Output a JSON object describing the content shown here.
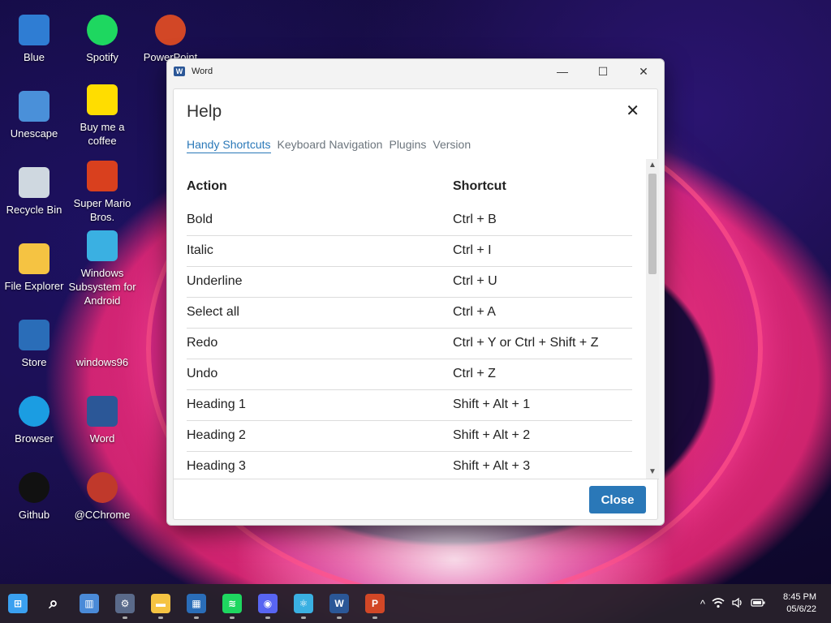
{
  "desktop": {
    "icons": [
      {
        "label": "Blue",
        "icon": "blue-person-icon",
        "color": "#2f7dd3"
      },
      {
        "label": "Spotify",
        "icon": "spotify-icon",
        "color": "#1ed760"
      },
      {
        "label": "PowerPoint",
        "icon": "powerpoint-icon",
        "color": "#d24726"
      },
      {
        "label": "Unescape",
        "icon": "unescape-icon",
        "color": "#4a90d9"
      },
      {
        "label": "Buy me a coffee",
        "icon": "coffee-icon",
        "color": "#ffdd00"
      },
      {
        "label": "Recycle Bin",
        "icon": "recycle-bin-icon",
        "color": "#cfd8e0"
      },
      {
        "label": "Super Mario Bros.",
        "icon": "mario-icon",
        "color": "#d9401e"
      },
      {
        "label": "File Explorer",
        "icon": "folder-icon",
        "color": "#f5c342"
      },
      {
        "label": "Windows Subsystem for Android",
        "icon": "android-subsystem-icon",
        "color": "#3ab0e2"
      },
      {
        "label": "Store",
        "icon": "store-icon",
        "color": "#2a6db8"
      },
      {
        "label": "windows96",
        "icon": "windows96-icon",
        "color": "#000000"
      },
      {
        "label": "Browser",
        "icon": "edge-icon",
        "color": "#1b9de2"
      },
      {
        "label": "Word",
        "icon": "word-icon",
        "color": "#2b5797"
      },
      {
        "label": "Github",
        "icon": "github-icon",
        "color": "#111111"
      },
      {
        "label": "@CChrome",
        "icon": "cchrome-icon",
        "color": "#c0392b"
      }
    ]
  },
  "window": {
    "title": "Word",
    "controls": {
      "minimize": "—",
      "maximize": "☐",
      "close": "✕"
    }
  },
  "dialog": {
    "title": "Help",
    "close_glyph": "✕",
    "tabs": [
      {
        "label": "Handy Shortcuts",
        "active": true
      },
      {
        "label": "Keyboard Navigation",
        "active": false
      },
      {
        "label": "Plugins",
        "active": false
      },
      {
        "label": "Version",
        "active": false
      }
    ],
    "table": {
      "headers": {
        "action": "Action",
        "shortcut": "Shortcut"
      },
      "rows": [
        {
          "action": "Bold",
          "shortcut": "Ctrl + B"
        },
        {
          "action": "Italic",
          "shortcut": "Ctrl + I"
        },
        {
          "action": "Underline",
          "shortcut": "Ctrl + U"
        },
        {
          "action": "Select all",
          "shortcut": "Ctrl + A"
        },
        {
          "action": "Redo",
          "shortcut": "Ctrl + Y or Ctrl + Shift + Z"
        },
        {
          "action": "Undo",
          "shortcut": "Ctrl + Z"
        },
        {
          "action": "Heading 1",
          "shortcut": "Shift + Alt + 1"
        },
        {
          "action": "Heading 2",
          "shortcut": "Shift + Alt + 2"
        },
        {
          "action": "Heading 3",
          "shortcut": "Shift + Alt + 3"
        }
      ]
    },
    "close_button": "Close",
    "accent": "#2a78b8"
  },
  "taskbar": {
    "apps": [
      {
        "name": "start-icon",
        "glyph": "⊞",
        "color": "#3aa0f0"
      },
      {
        "name": "search-icon",
        "glyph": "⌕",
        "color": "transparent"
      },
      {
        "name": "widgets-icon",
        "glyph": "▥",
        "color": "#4a8ad8"
      },
      {
        "name": "settings-icon",
        "glyph": "⚙",
        "color": "#5a6a8a"
      },
      {
        "name": "file-explorer-icon",
        "glyph": "▬",
        "color": "#f5c342"
      },
      {
        "name": "store-icon",
        "glyph": "▦",
        "color": "#2a6db8"
      },
      {
        "name": "spotify-icon",
        "glyph": "≋",
        "color": "#1ed760"
      },
      {
        "name": "discord-icon",
        "glyph": "◉",
        "color": "#5865f2"
      },
      {
        "name": "android-subsystem-icon",
        "glyph": "⚛",
        "color": "#3ab0e2"
      },
      {
        "name": "word-icon",
        "glyph": "W",
        "color": "#2b5797"
      },
      {
        "name": "powerpoint-icon",
        "glyph": "P",
        "color": "#d24726"
      }
    ],
    "tray": {
      "chevron": "^",
      "wifi": "wifi",
      "volume": "🔊",
      "battery": "▭"
    },
    "time": "8:45 PM",
    "date": "05/6/22"
  }
}
